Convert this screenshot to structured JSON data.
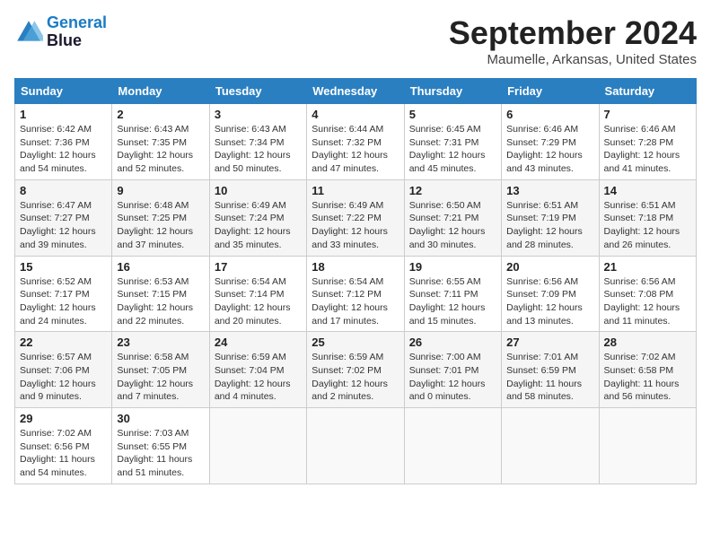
{
  "header": {
    "logo_line1": "General",
    "logo_line2": "Blue",
    "month_title": "September 2024",
    "location": "Maumelle, Arkansas, United States"
  },
  "weekdays": [
    "Sunday",
    "Monday",
    "Tuesday",
    "Wednesday",
    "Thursday",
    "Friday",
    "Saturday"
  ],
  "weeks": [
    [
      {
        "day": "1",
        "sunrise": "6:42 AM",
        "sunset": "7:36 PM",
        "daylight": "12 hours and 54 minutes."
      },
      {
        "day": "2",
        "sunrise": "6:43 AM",
        "sunset": "7:35 PM",
        "daylight": "12 hours and 52 minutes."
      },
      {
        "day": "3",
        "sunrise": "6:43 AM",
        "sunset": "7:34 PM",
        "daylight": "12 hours and 50 minutes."
      },
      {
        "day": "4",
        "sunrise": "6:44 AM",
        "sunset": "7:32 PM",
        "daylight": "12 hours and 47 minutes."
      },
      {
        "day": "5",
        "sunrise": "6:45 AM",
        "sunset": "7:31 PM",
        "daylight": "12 hours and 45 minutes."
      },
      {
        "day": "6",
        "sunrise": "6:46 AM",
        "sunset": "7:29 PM",
        "daylight": "12 hours and 43 minutes."
      },
      {
        "day": "7",
        "sunrise": "6:46 AM",
        "sunset": "7:28 PM",
        "daylight": "12 hours and 41 minutes."
      }
    ],
    [
      {
        "day": "8",
        "sunrise": "6:47 AM",
        "sunset": "7:27 PM",
        "daylight": "12 hours and 39 minutes."
      },
      {
        "day": "9",
        "sunrise": "6:48 AM",
        "sunset": "7:25 PM",
        "daylight": "12 hours and 37 minutes."
      },
      {
        "day": "10",
        "sunrise": "6:49 AM",
        "sunset": "7:24 PM",
        "daylight": "12 hours and 35 minutes."
      },
      {
        "day": "11",
        "sunrise": "6:49 AM",
        "sunset": "7:22 PM",
        "daylight": "12 hours and 33 minutes."
      },
      {
        "day": "12",
        "sunrise": "6:50 AM",
        "sunset": "7:21 PM",
        "daylight": "12 hours and 30 minutes."
      },
      {
        "day": "13",
        "sunrise": "6:51 AM",
        "sunset": "7:19 PM",
        "daylight": "12 hours and 28 minutes."
      },
      {
        "day": "14",
        "sunrise": "6:51 AM",
        "sunset": "7:18 PM",
        "daylight": "12 hours and 26 minutes."
      }
    ],
    [
      {
        "day": "15",
        "sunrise": "6:52 AM",
        "sunset": "7:17 PM",
        "daylight": "12 hours and 24 minutes."
      },
      {
        "day": "16",
        "sunrise": "6:53 AM",
        "sunset": "7:15 PM",
        "daylight": "12 hours and 22 minutes."
      },
      {
        "day": "17",
        "sunrise": "6:54 AM",
        "sunset": "7:14 PM",
        "daylight": "12 hours and 20 minutes."
      },
      {
        "day": "18",
        "sunrise": "6:54 AM",
        "sunset": "7:12 PM",
        "daylight": "12 hours and 17 minutes."
      },
      {
        "day": "19",
        "sunrise": "6:55 AM",
        "sunset": "7:11 PM",
        "daylight": "12 hours and 15 minutes."
      },
      {
        "day": "20",
        "sunrise": "6:56 AM",
        "sunset": "7:09 PM",
        "daylight": "12 hours and 13 minutes."
      },
      {
        "day": "21",
        "sunrise": "6:56 AM",
        "sunset": "7:08 PM",
        "daylight": "12 hours and 11 minutes."
      }
    ],
    [
      {
        "day": "22",
        "sunrise": "6:57 AM",
        "sunset": "7:06 PM",
        "daylight": "12 hours and 9 minutes."
      },
      {
        "day": "23",
        "sunrise": "6:58 AM",
        "sunset": "7:05 PM",
        "daylight": "12 hours and 7 minutes."
      },
      {
        "day": "24",
        "sunrise": "6:59 AM",
        "sunset": "7:04 PM",
        "daylight": "12 hours and 4 minutes."
      },
      {
        "day": "25",
        "sunrise": "6:59 AM",
        "sunset": "7:02 PM",
        "daylight": "12 hours and 2 minutes."
      },
      {
        "day": "26",
        "sunrise": "7:00 AM",
        "sunset": "7:01 PM",
        "daylight": "12 hours and 0 minutes."
      },
      {
        "day": "27",
        "sunrise": "7:01 AM",
        "sunset": "6:59 PM",
        "daylight": "11 hours and 58 minutes."
      },
      {
        "day": "28",
        "sunrise": "7:02 AM",
        "sunset": "6:58 PM",
        "daylight": "11 hours and 56 minutes."
      }
    ],
    [
      {
        "day": "29",
        "sunrise": "7:02 AM",
        "sunset": "6:56 PM",
        "daylight": "11 hours and 54 minutes."
      },
      {
        "day": "30",
        "sunrise": "7:03 AM",
        "sunset": "6:55 PM",
        "daylight": "11 hours and 51 minutes."
      },
      null,
      null,
      null,
      null,
      null
    ]
  ]
}
